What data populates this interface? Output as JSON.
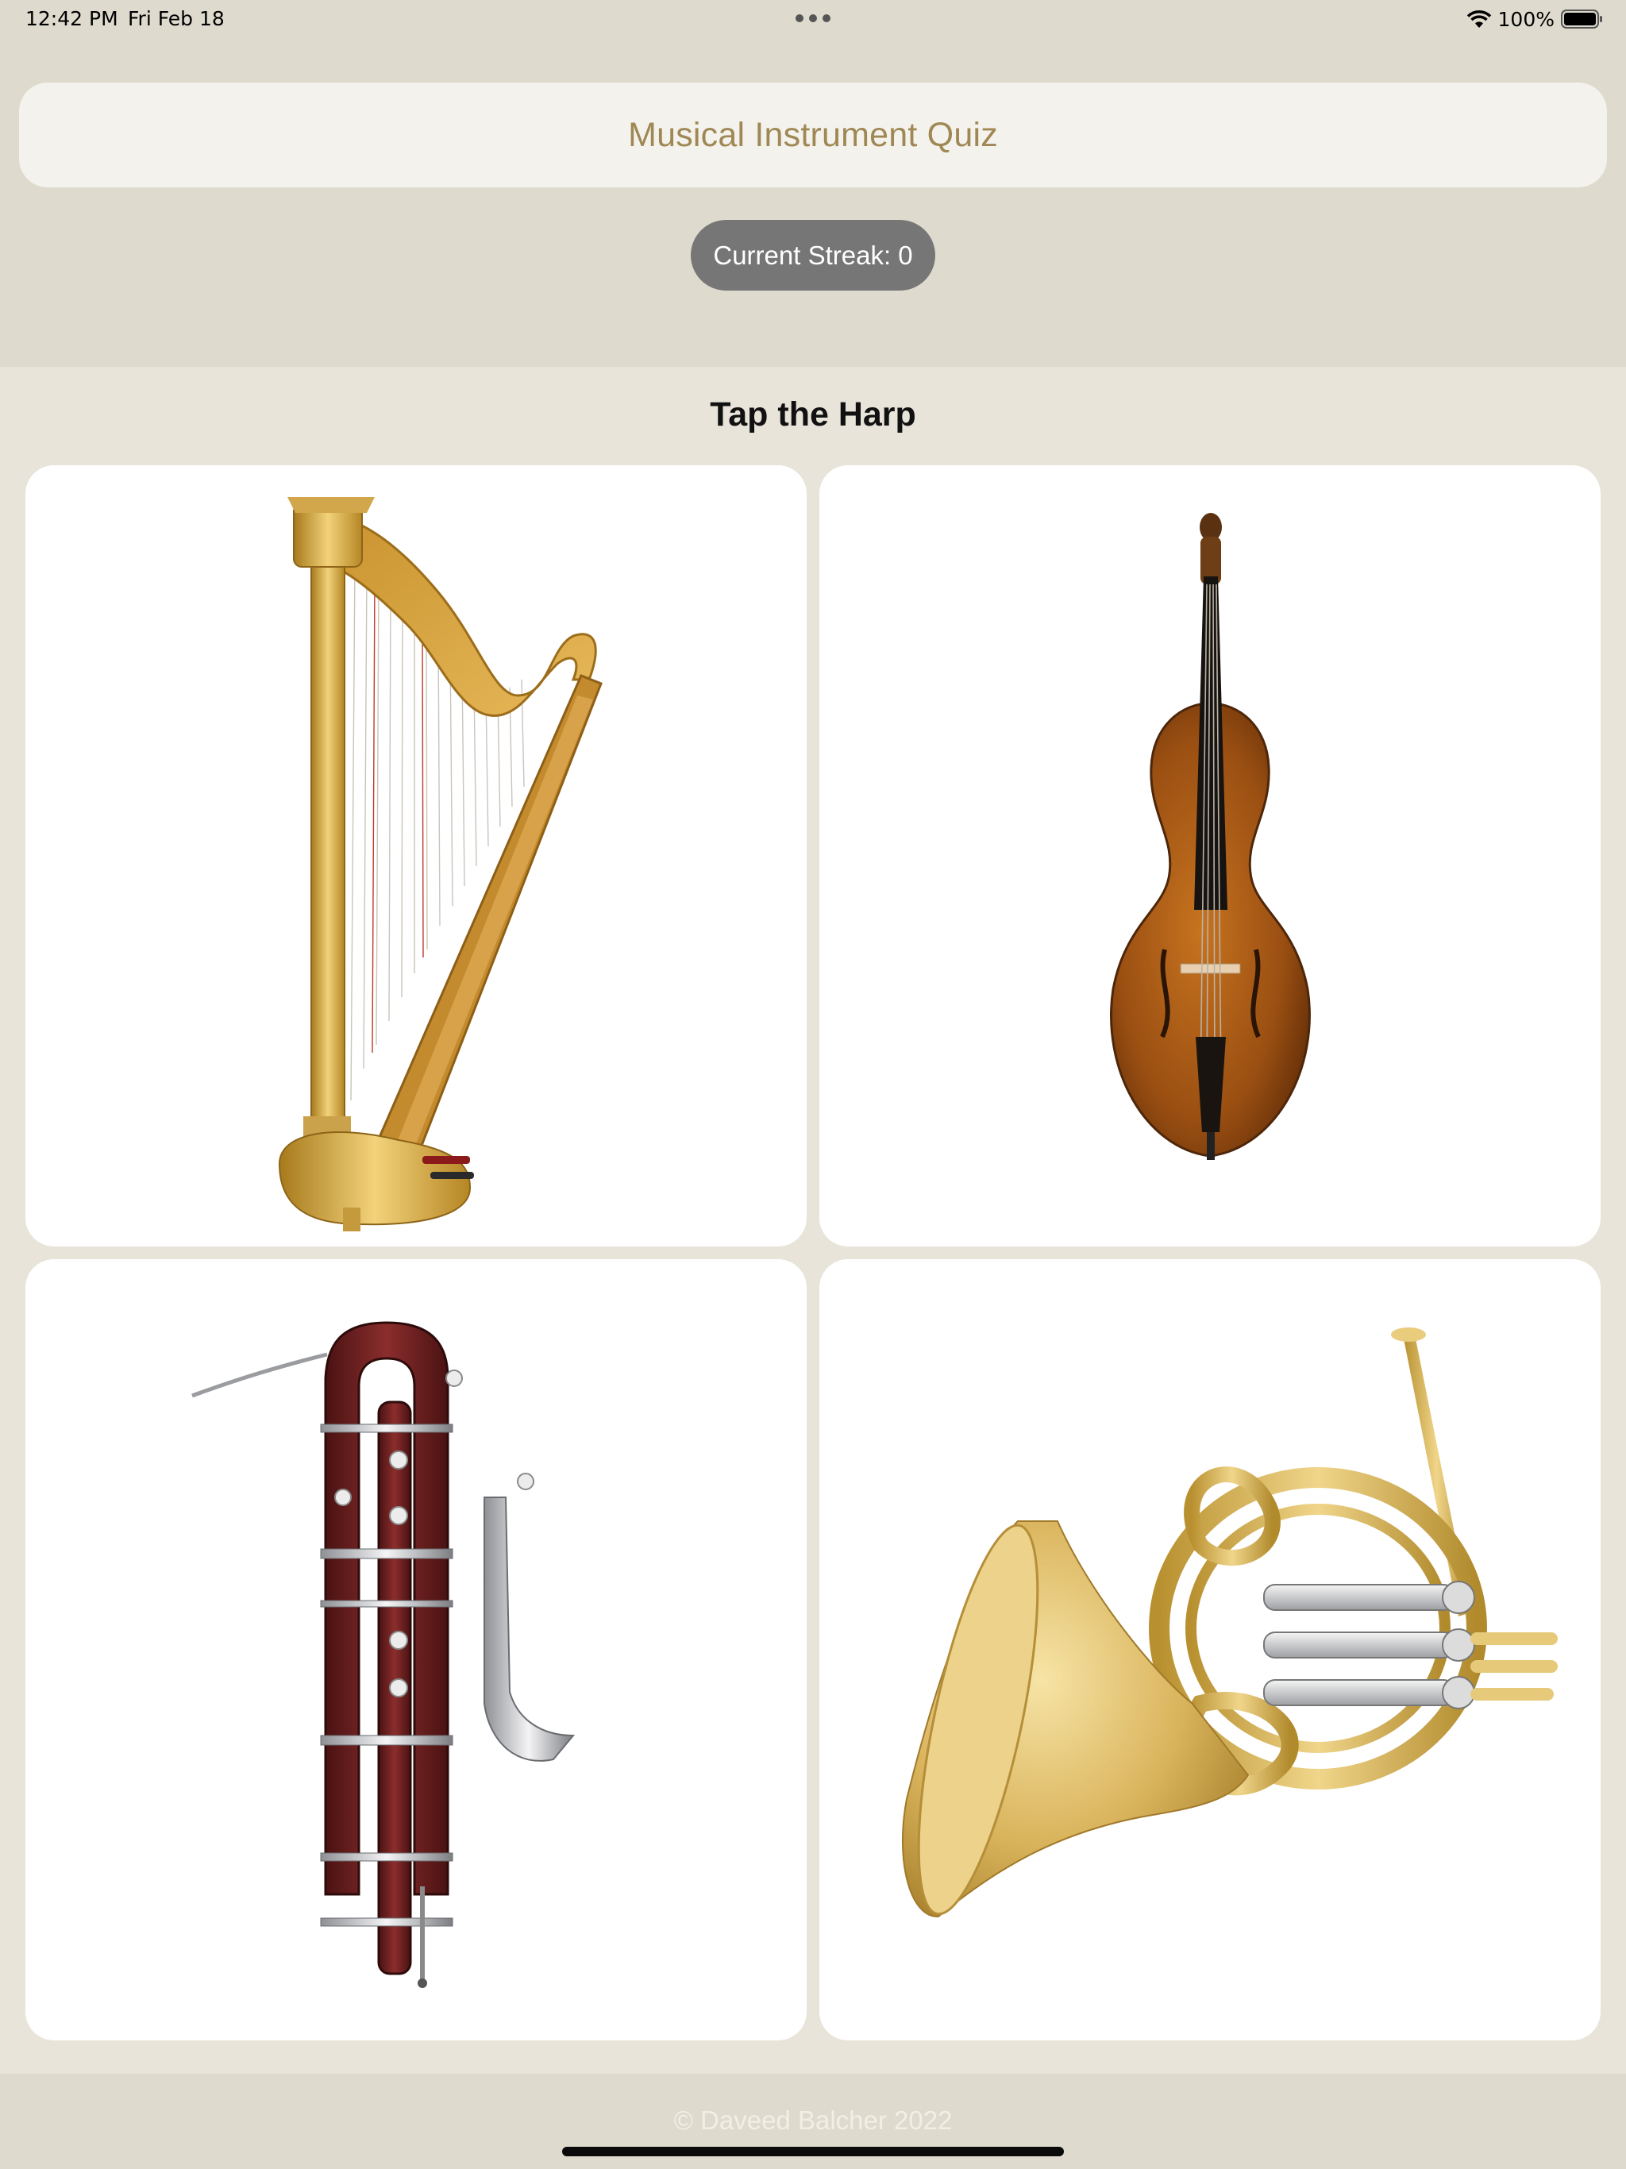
{
  "status_bar": {
    "time": "12:42 PM",
    "date": "Fri Feb 18",
    "battery": "100%"
  },
  "header": {
    "title": "Musical Instrument Quiz",
    "streak": "Current Streak: 0"
  },
  "quiz": {
    "prompt": "Tap the Harp",
    "options": [
      {
        "instrument": "harp-image"
      },
      {
        "instrument": "double-bass-image"
      },
      {
        "instrument": "contrabassoon-image"
      },
      {
        "instrument": "french-horn-image"
      }
    ]
  },
  "footer": {
    "copyright": "© Daveed Balcher 2022"
  },
  "colors": {
    "background": "#e8e4d9",
    "header_band": "#dedacd",
    "title_text": "#a08855",
    "streak_pill": "#767676",
    "card": "#ffffff"
  }
}
